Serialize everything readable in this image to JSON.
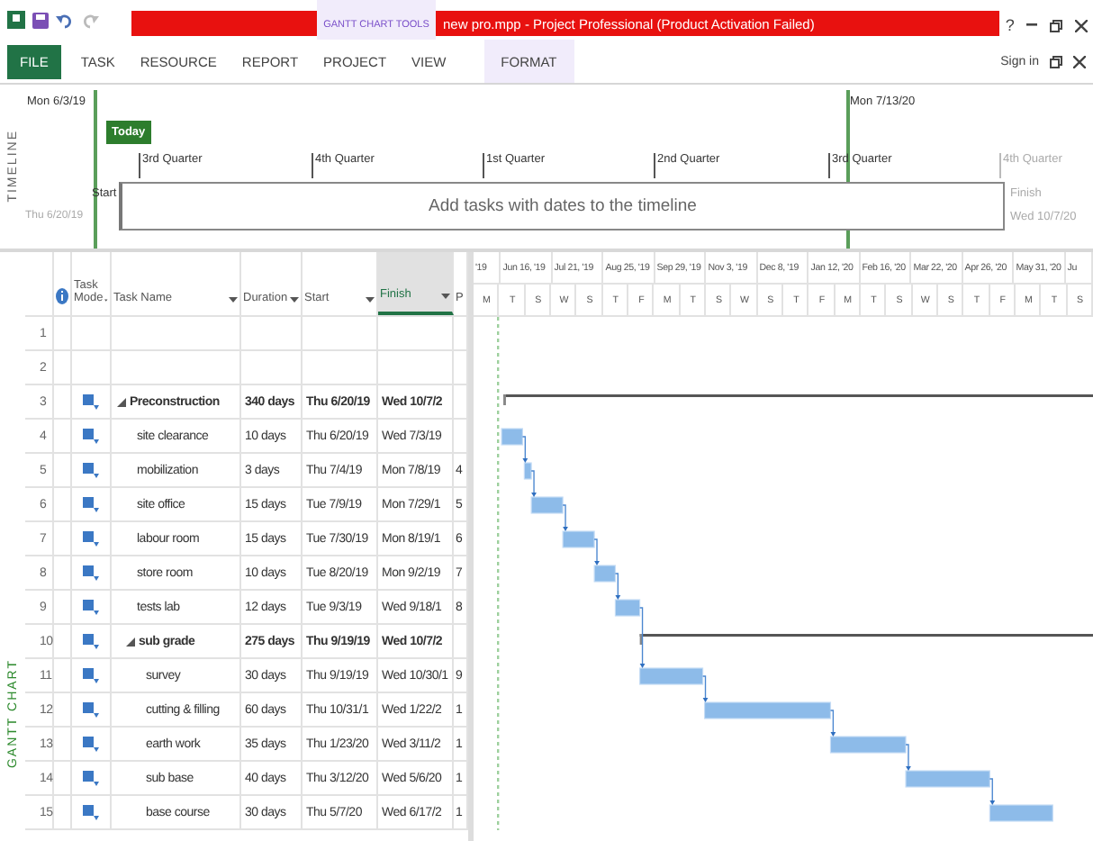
{
  "title_bar": {
    "contextual_label": "GANTT CHART TOOLS",
    "title": "new pro.mpp -  Project Professional (Product Activation Failed)",
    "help": "?"
  },
  "ribbon": {
    "tabs": [
      {
        "label": "FILE",
        "kind": "file"
      },
      {
        "label": "TASK",
        "kind": "plain"
      },
      {
        "label": "RESOURCE",
        "kind": "plain"
      },
      {
        "label": "REPORT",
        "kind": "plain"
      },
      {
        "label": "PROJECT",
        "kind": "plain"
      },
      {
        "label": "VIEW",
        "kind": "plain"
      },
      {
        "label": "FORMAT",
        "kind": "contextual"
      }
    ],
    "sign_in": "Sign in"
  },
  "timeline": {
    "label": "TIMELINE",
    "range_start": "Mon 6/3/19",
    "range_end": "Mon 7/13/20",
    "today": "Today",
    "quarters": [
      {
        "label": "3rd Quarter",
        "muted": false
      },
      {
        "label": "4th Quarter",
        "muted": false
      },
      {
        "label": "1st Quarter",
        "muted": false
      },
      {
        "label": "2nd Quarter",
        "muted": false
      },
      {
        "label": "3rd Quarter",
        "muted": false
      },
      {
        "label": "4th Quarter",
        "muted": true
      }
    ],
    "start_label": "Start",
    "start_value": "Thu 6/20/19",
    "finish_label": "Finish",
    "finish_value": "Wed 10/7/20",
    "placeholder": "Add tasks with dates to the timeline"
  },
  "gantt": {
    "side_label": "GANTT CHART",
    "columns": [
      {
        "label": "Task Mode",
        "filter": true,
        "selected": false
      },
      {
        "label": "Task Name",
        "filter": true,
        "selected": false
      },
      {
        "label": "Duration",
        "filter": true,
        "selected": false
      },
      {
        "label": "Start",
        "filter": true,
        "selected": false
      },
      {
        "label": "Finish",
        "filter": true,
        "selected": true
      },
      {
        "label": "P",
        "selected": false
      }
    ],
    "rows": [
      {
        "number": "1"
      },
      {
        "number": "2"
      },
      {
        "number": "3",
        "kind": "summary",
        "expanded": true,
        "name": "Preconstruction",
        "duration": "340 days",
        "start": "Thu 6/20/19",
        "finish": "Wed 10/7/2",
        "children": [
          {
            "number": "4",
            "kind": "task",
            "name": "site clearance",
            "duration": "10 days",
            "start": "Thu 6/20/19",
            "finish": "Wed 7/3/19"
          },
          {
            "number": "5",
            "kind": "task",
            "name": "mobilization",
            "duration": "3 days",
            "start": "Thu 7/4/19",
            "finish": "Mon 7/8/19",
            "pred": "4"
          },
          {
            "number": "6",
            "kind": "task",
            "name": "site office",
            "duration": "15 days",
            "start": "Tue 7/9/19",
            "finish": "Mon 7/29/1",
            "pred": "5"
          },
          {
            "number": "7",
            "kind": "task",
            "name": "labour room",
            "duration": "15 days",
            "start": "Tue 7/30/19",
            "finish": "Mon 8/19/1",
            "pred": "6"
          },
          {
            "number": "8",
            "kind": "task",
            "name": "store room",
            "duration": "10 days",
            "start": "Tue 8/20/19",
            "finish": "Mon 9/2/19",
            "pred": "7"
          },
          {
            "number": "9",
            "kind": "task",
            "name": "tests lab",
            "duration": "12 days",
            "start": "Tue 9/3/19",
            "finish": "Wed 9/18/1",
            "pred": "8"
          },
          {
            "number": "10",
            "kind": "summary",
            "expanded": true,
            "name": "sub grade",
            "duration": "275 days",
            "start": "Thu 9/19/19",
            "finish": "Wed 10/7/2",
            "children": [
              {
                "number": "11",
                "kind": "task",
                "name": "survey",
                "duration": "30 days",
                "start": "Thu 9/19/19",
                "finish": "Wed 10/30/1",
                "pred": "9"
              },
              {
                "number": "12",
                "kind": "task",
                "name": "cutting & filling",
                "duration": "60 days",
                "start": "Thu 10/31/1",
                "finish": "Wed 1/22/2",
                "pred": "1"
              },
              {
                "number": "13",
                "kind": "task",
                "name": "earth work",
                "duration": "35 days",
                "start": "Thu 1/23/20",
                "finish": "Wed 3/11/2",
                "pred": "1"
              },
              {
                "number": "14",
                "kind": "task",
                "name": "sub base",
                "duration": "40 days",
                "start": "Thu 3/12/20",
                "finish": "Wed 5/6/20",
                "pred": "1"
              },
              {
                "number": "15",
                "kind": "task",
                "name": "base course",
                "duration": "30 days",
                "start": "Thu 5/7/20",
                "finish": "Wed 6/17/2",
                "pred": "1"
              }
            ]
          }
        ]
      }
    ],
    "timescale_top": [
      "'19",
      "Jun 16, '19",
      "Jul 21, '19",
      "Aug 25, '19",
      "Sep 29, '19",
      "Nov 3, '19",
      "Dec 8, '19",
      "Jan 12, '20",
      "Feb 16, '20",
      "Mar 22, '20",
      "Apr 26, '20",
      "May 31, '20",
      "Ju"
    ],
    "timescale_bottom": [
      "M",
      "T",
      "S",
      "W",
      "S",
      "T",
      "F",
      "M",
      "T",
      "S",
      "W",
      "S",
      "T",
      "F",
      "M",
      "T",
      "S",
      "W",
      "S",
      "T",
      "F",
      "M",
      "T",
      "S"
    ]
  }
}
